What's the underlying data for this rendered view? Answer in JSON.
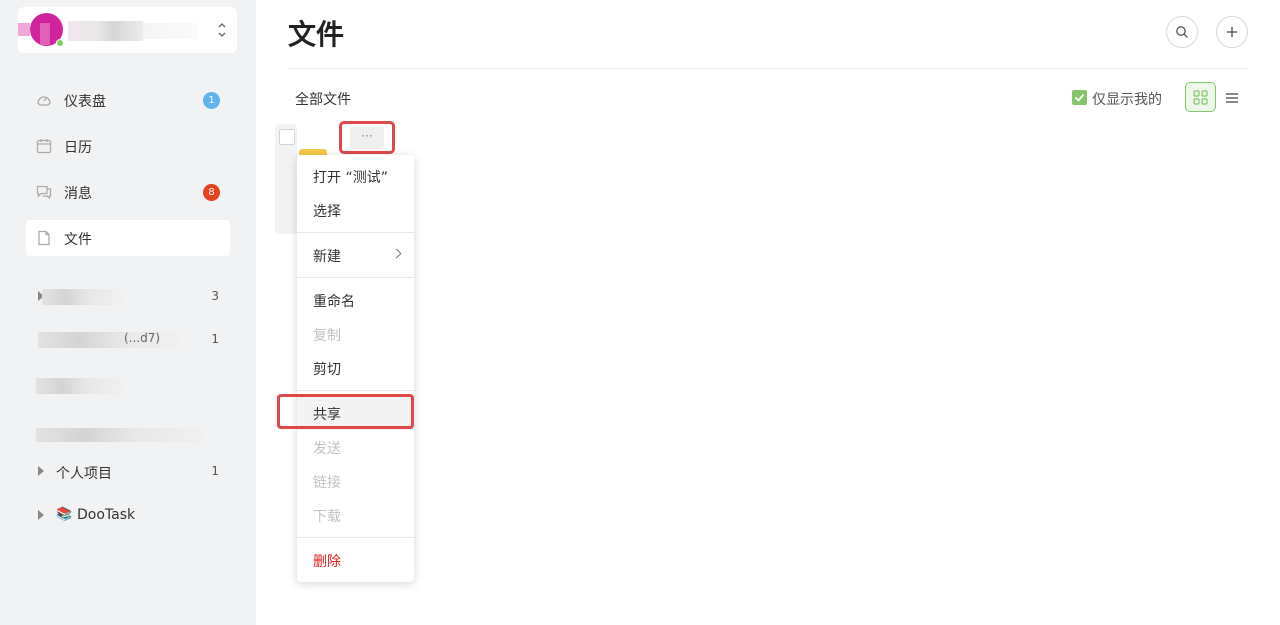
{
  "sidebar": {
    "nav": [
      {
        "label": "仪表盘",
        "badge": "1"
      },
      {
        "label": "日历"
      },
      {
        "label": "消息",
        "badge": "8"
      },
      {
        "label": "文件"
      }
    ],
    "projects": [
      {
        "count": "3"
      },
      {
        "count": "1",
        "partial_label": "(...d7)"
      },
      {},
      {},
      {
        "label": "个人项目",
        "count": "1"
      },
      {
        "label": "DooTask",
        "emoji": "📚"
      }
    ]
  },
  "main": {
    "title": "文件",
    "breadcrumb": "全部文件",
    "only_mine_label": "仅显示我的",
    "more_label": "···"
  },
  "menu": {
    "open": "打开 “测试”",
    "select": "选择",
    "new": "新建",
    "rename": "重命名",
    "copy": "复制",
    "cut": "剪切",
    "share": "共享",
    "send": "发送",
    "link": "链接",
    "download": "下载",
    "delete": "删除"
  },
  "colors": {
    "accent_green": "#84c56a",
    "highlight_red": "#e0484a",
    "danger": "#e5201d",
    "badge_blue": "#5eb4f1",
    "badge_red": "#e5421d"
  }
}
